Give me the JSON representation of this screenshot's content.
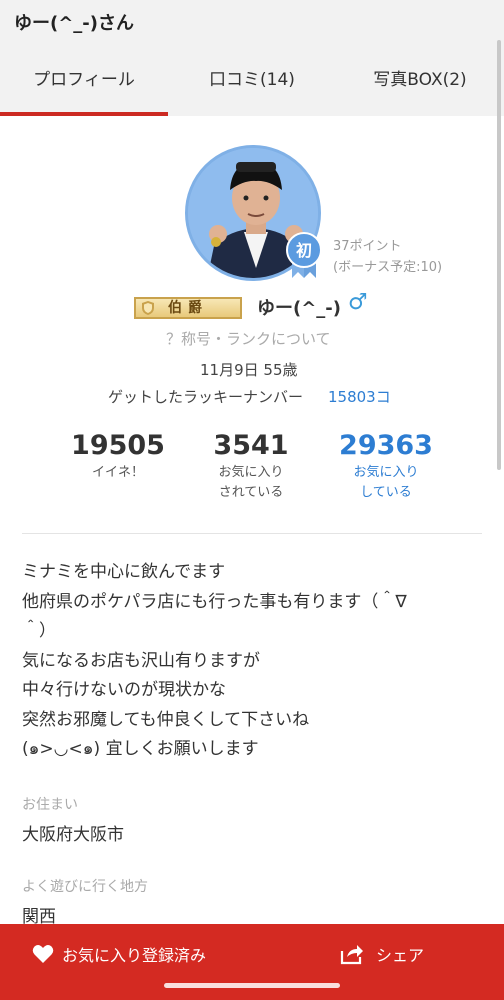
{
  "header": {
    "title": "ゆー(^_-)さん"
  },
  "tabs": [
    {
      "label": "プロフィール"
    },
    {
      "label": "口コミ(14)"
    },
    {
      "label": "写真BOX(2)"
    }
  ],
  "profile": {
    "points_line1": "37ポイント",
    "points_line2": "(ボーナス予定:10)",
    "rank_badge": "初",
    "title_plate": "伯爵",
    "username": "ゆー(^_-)",
    "gender_symbol": "♂",
    "rank_link": "？称号・ランクについて",
    "birthday": "11月9日 55歳",
    "lucky_label": "ゲットしたラッキーナンバー",
    "lucky_value": "15803コ"
  },
  "stats": [
    {
      "num": "19505",
      "label_1": "イイネ！",
      "label_2": ""
    },
    {
      "num": "3541",
      "label_1": "お気に入り",
      "label_2": "されている"
    },
    {
      "num": "29363",
      "label_1": "お気に入り",
      "label_2": "している"
    }
  ],
  "bio": {
    "line1": "ミナミを中心に飲んでます",
    "line2": "他府県のポケパラ店にも行った事も有ります（＾∇",
    "line3": "＾）",
    "line4": "気になるお店も沢山有りますが",
    "line5": "中々行けないのが現状かな",
    "line6": "突然お邪魔しても仲良くして下さいね",
    "line7": "(๑>◡<๑) 宜しくお願いします"
  },
  "residence": {
    "label": "お住まい",
    "value": "大阪府大阪市"
  },
  "area": {
    "label": "よく遊びに行く地方",
    "value": "関西"
  },
  "bottom_bar": {
    "favorite_label": "お気に入り登録済み",
    "share_label": "シェア"
  },
  "colors": {
    "accent": "#d42a22",
    "link": "#2d7dd2",
    "avatar_bg": "#8fbcee"
  }
}
